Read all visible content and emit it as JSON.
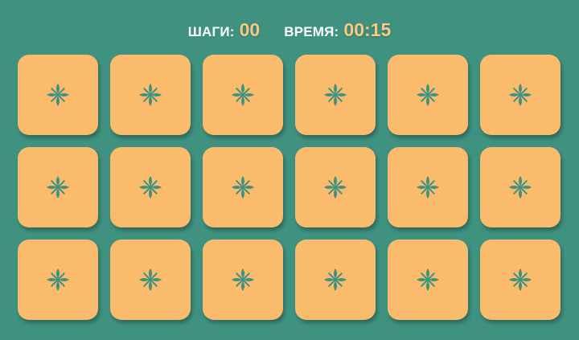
{
  "stats": {
    "moves_label": "ШАГИ:",
    "moves_value": "00",
    "time_label": "ВРЕМЯ:",
    "time_value": "00:15"
  },
  "board": {
    "card_back_icon": "flower-icon",
    "cards": [
      {},
      {},
      {},
      {},
      {},
      {},
      {},
      {},
      {},
      {},
      {},
      {},
      {},
      {},
      {},
      {},
      {},
      {}
    ]
  },
  "colors": {
    "background": "#3f9280",
    "card": "#fbbb6c",
    "value_text": "#f8c983",
    "icon": "#3f9280"
  }
}
